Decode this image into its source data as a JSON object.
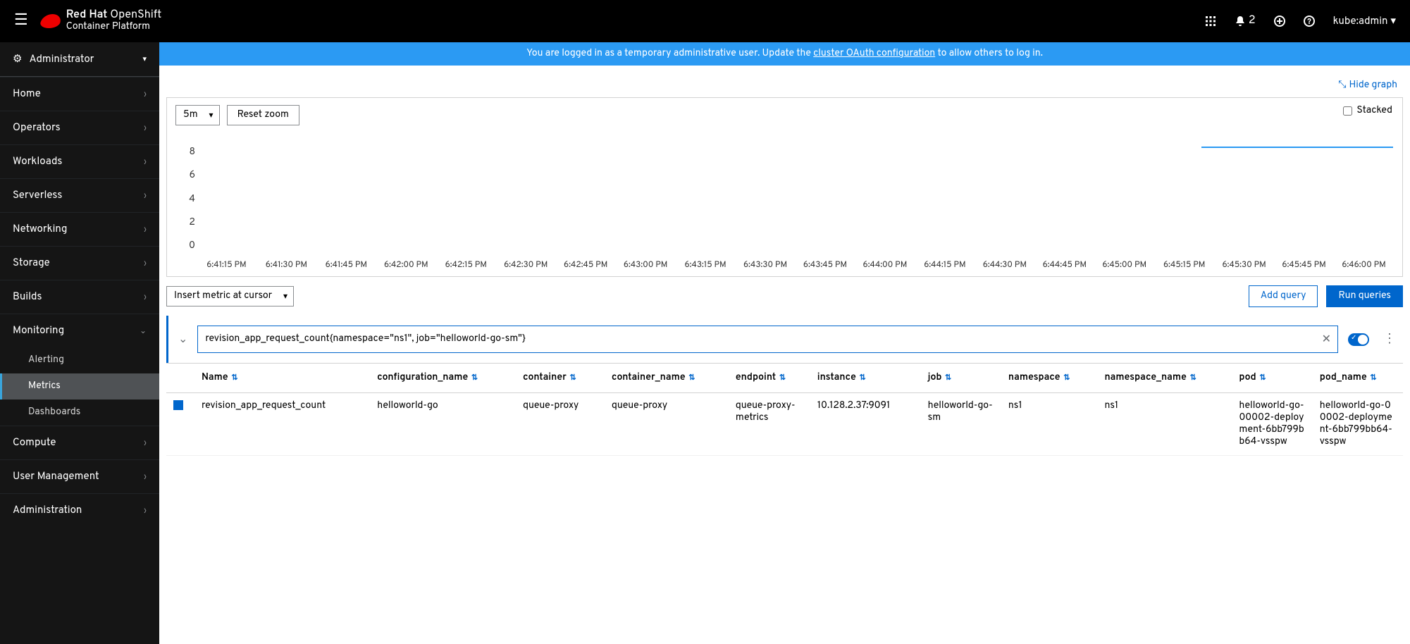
{
  "brand": {
    "line1": "Red Hat",
    "line2": "OpenShift",
    "line3": "Container Platform"
  },
  "header": {
    "bell_count": "2",
    "user": "kube:admin"
  },
  "perspective": {
    "label": "Administrator"
  },
  "nav": {
    "items": [
      {
        "label": "Home",
        "expanded": false
      },
      {
        "label": "Operators",
        "expanded": false
      },
      {
        "label": "Workloads",
        "expanded": false
      },
      {
        "label": "Serverless",
        "expanded": false
      },
      {
        "label": "Networking",
        "expanded": false
      },
      {
        "label": "Storage",
        "expanded": false
      },
      {
        "label": "Builds",
        "expanded": false
      },
      {
        "label": "Monitoring",
        "expanded": true,
        "sub": [
          "Alerting",
          "Metrics",
          "Dashboards"
        ],
        "active_sub": "Metrics"
      },
      {
        "label": "Compute",
        "expanded": false
      },
      {
        "label": "User Management",
        "expanded": false
      },
      {
        "label": "Administration",
        "expanded": false
      }
    ]
  },
  "banner": {
    "pre": "You are logged in as a temporary administrative user. Update the ",
    "link": "cluster OAuth configuration",
    "post": " to allow others to log in."
  },
  "hide_graph": "Hide graph",
  "chart": {
    "time_range": "5m",
    "reset_zoom": "Reset zoom",
    "stacked": "Stacked"
  },
  "chart_data": {
    "type": "line",
    "title": "",
    "ylim": [
      0,
      8
    ],
    "y_ticks": [
      8,
      6,
      4,
      2,
      0
    ],
    "x_ticks": [
      "6:41:15 PM",
      "6:41:30 PM",
      "6:41:45 PM",
      "6:42:00 PM",
      "6:42:15 PM",
      "6:42:30 PM",
      "6:42:45 PM",
      "6:43:00 PM",
      "6:43:15 PM",
      "6:43:30 PM",
      "6:43:45 PM",
      "6:44:00 PM",
      "6:44:15 PM",
      "6:44:30 PM",
      "6:44:45 PM",
      "6:45:00 PM",
      "6:45:15 PM",
      "6:45:30 PM",
      "6:45:45 PM",
      "6:46:00 PM"
    ],
    "series": [
      {
        "name": "revision_app_request_count",
        "color": "#2b9af3",
        "segments": [
          {
            "x_start_frac": 0.84,
            "x_end_frac": 1.0,
            "value": 8
          }
        ]
      }
    ]
  },
  "query_bar": {
    "insert_metric": "Insert metric at cursor",
    "add_query": "Add query",
    "run_queries": "Run queries"
  },
  "query": {
    "expression": "revision_app_request_count{namespace=\"ns1\", job=\"helloworld-go-sm\"}"
  },
  "table": {
    "columns": [
      "Name",
      "configuration_name",
      "container",
      "container_name",
      "endpoint",
      "instance",
      "job",
      "namespace",
      "namespace_name",
      "pod",
      "pod_name"
    ],
    "rows": [
      {
        "Name": "revision_app_request_count",
        "configuration_name": "helloworld-go",
        "container": "queue-proxy",
        "container_name": "queue-proxy",
        "endpoint": "queue-proxy-metrics",
        "instance": "10.128.2.37:9091",
        "job": "helloworld-go-sm",
        "namespace": "ns1",
        "namespace_name": "ns1",
        "pod": "helloworld-go-00002-deployment-6bb799bb64-vsspw",
        "pod_name": "helloworld-go-00002-deployment-6bb799bb64-vsspw"
      }
    ]
  }
}
